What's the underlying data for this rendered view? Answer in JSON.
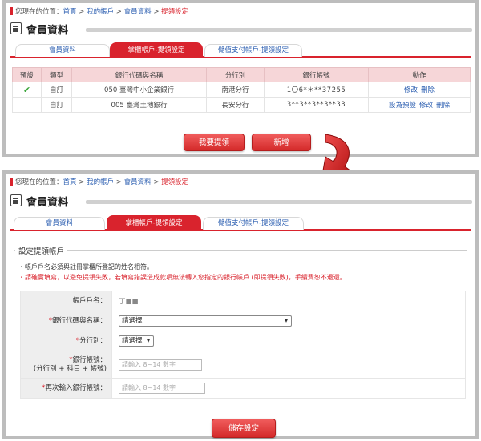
{
  "breadcrumb": {
    "prefix": "您現在的位置：",
    "items": [
      "首頁",
      "我的帳戶",
      "會員資料",
      "提領設定"
    ],
    "separator": " > "
  },
  "page_title": "會員資料",
  "tabs": [
    {
      "label": "會員資料",
      "active": false
    },
    {
      "label": "掌櫃帳戶-提領設定",
      "active": true
    },
    {
      "label": "儲值支付帳戶-提領設定",
      "active": false
    }
  ],
  "table": {
    "headers": [
      "預設",
      "類型",
      "銀行代碼與名稱",
      "分行別",
      "銀行帳號",
      "動作"
    ],
    "rows": [
      {
        "default": "✔",
        "type": "自訂",
        "bank": "050 臺灣中小企業銀行",
        "branch": "南港分行",
        "account": "1〇6*＊**37255",
        "actions": [
          "修改",
          "刪除"
        ]
      },
      {
        "default": "",
        "type": "自訂",
        "bank": "005 臺灣土地銀行",
        "branch": "長安分行",
        "account": "3**3**3**3**33",
        "actions": [
          "設為預設",
          "修改",
          "刪除"
        ]
      }
    ]
  },
  "buttons": {
    "withdraw": "我要提領",
    "add": "新增",
    "save": "儲存設定"
  },
  "form": {
    "section_title": "設定提領帳戶",
    "notes": [
      "・帳戶戶名必須與註冊掌櫃所登記的姓名相符。",
      "・請確實填寫，以避免提領失敗，若填寫錯誤造成款項無法轉入您指定的銀行帳戶 (即提領失敗)，手續費恕不退還。"
    ],
    "rows": {
      "account_name": {
        "label": "帳戶戶名：",
        "value": "丁■■"
      },
      "bank": {
        "label": "銀行代碼與名稱：",
        "value": "請選擇"
      },
      "branch": {
        "label": "分行別：",
        "value": "請選擇"
      },
      "account_no": {
        "label": "銀行帳號：",
        "sublabel": "(分行別 + 科目 + 帳號)",
        "placeholder": "請輸入 8~14 數字"
      },
      "account_no_confirm": {
        "label": "再次輸入銀行帳號：",
        "placeholder": "請輸入 8~14 數字"
      }
    }
  },
  "colors": {
    "accent": "#d9232d",
    "link": "#2a5db0",
    "table_header": "#f6d6d8"
  }
}
